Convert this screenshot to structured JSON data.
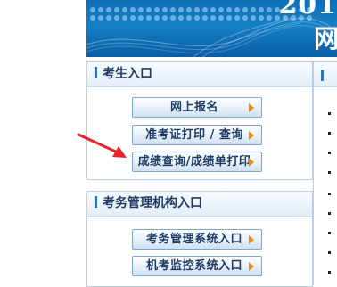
{
  "banner": {
    "year_text": "201",
    "glyph_text": "网"
  },
  "candidate_panel": {
    "title": "考生入口",
    "buttons": [
      {
        "label": "网上报名",
        "icon": "arrow-right-icon"
      },
      {
        "label": "准考证打印 / 查询",
        "icon": "arrow-right-icon"
      },
      {
        "label": "成绩查询/成绩单打印",
        "icon": "arrow-right-icon"
      }
    ]
  },
  "org_panel": {
    "title": "考务管理机构入口",
    "buttons": [
      {
        "label": "考务管理系统入口",
        "icon": "arrow-right-icon"
      },
      {
        "label": "机考监控系统入口",
        "icon": "arrow-right-icon"
      }
    ]
  },
  "colors": {
    "banner_blue": "#1580c6",
    "accent_arrow": "#f08a00",
    "annotation_red": "#e8232a",
    "header_text": "#1f3b63"
  }
}
